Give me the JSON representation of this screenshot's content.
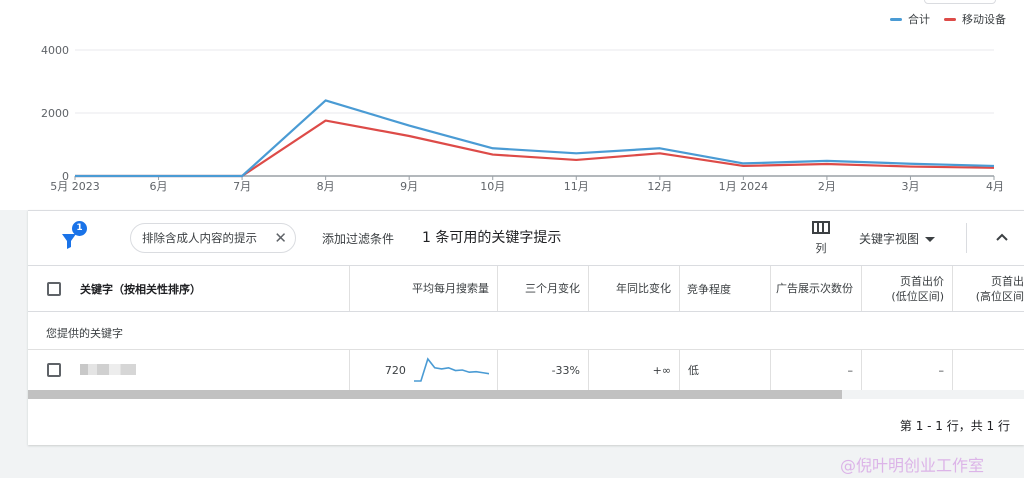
{
  "chart_data": {
    "type": "line",
    "x": [
      "5月 2023",
      "6月",
      "7月",
      "8月",
      "9月",
      "10月",
      "11月",
      "12月",
      "1月 2024",
      "2月",
      "3月",
      "4月"
    ],
    "series": [
      {
        "name": "合计",
        "color": "#4a9bd4",
        "values": [
          0,
          0,
          0,
          2400,
          1600,
          880,
          720,
          880,
          400,
          480,
          390,
          320
        ]
      },
      {
        "name": "移动设备",
        "color": "#dd4b48",
        "values": [
          0,
          0,
          0,
          1760,
          1270,
          680,
          510,
          720,
          320,
          380,
          300,
          260
        ]
      }
    ],
    "yticks": [
      "0",
      "2000",
      "4000"
    ],
    "ylim": [
      0,
      4000
    ],
    "grid": true,
    "legend_position": "top-right"
  },
  "toolbar": {
    "filter_count": "1",
    "chip_label": "排除含成人内容的提示",
    "chip_close": "✕",
    "add_filter": "添加过滤条件",
    "title": "1 条可用的关键字提示",
    "columns_label": "列",
    "view_select": "关键字视图"
  },
  "table": {
    "headers": {
      "keyword": "关键字（按相关性排序）",
      "avg_monthly": "平均每月搜索量",
      "three_month": "三个月变化",
      "yoy": "年同比变化",
      "competition": "竞争程度",
      "impression": "广告展示次数份",
      "bid_low_1": "页首出价",
      "bid_low_2": "(低位区间)",
      "bid_high_1": "页首出",
      "bid_high_2": "(高位区间"
    },
    "section_label": "您提供的关键字",
    "rows": [
      {
        "avg_monthly": "720",
        "trend": [
          0,
          0,
          4,
          2.4,
          2.2,
          2.4,
          1.9,
          2.0,
          1.6,
          1.7,
          1.5,
          1.3
        ],
        "three_month": "-33%",
        "yoy": "+∞",
        "competition": "低",
        "impression": "–",
        "bid_low": "–"
      }
    ]
  },
  "pagination": "第 1 - 1 行，共 1 行",
  "watermark": "@倪叶明创业工作室"
}
